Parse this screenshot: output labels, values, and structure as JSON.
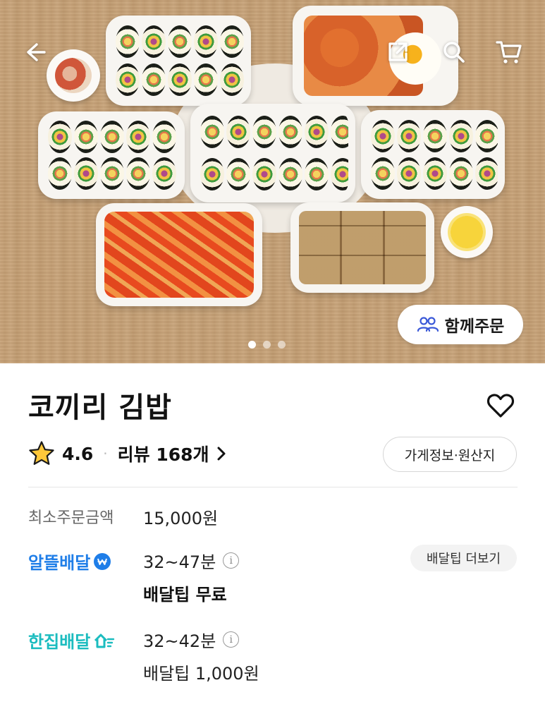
{
  "header": {
    "back_icon": "back-arrow-icon",
    "share_icon": "share-icon",
    "search_icon": "search-icon",
    "cart_icon": "cart-icon"
  },
  "hero": {
    "together_order_label": "함께주문",
    "together_icon": "people-group-icon",
    "carousel": {
      "total": 3,
      "active_index": 1
    }
  },
  "store": {
    "name": "코끼리 김밥",
    "rating": "4.6",
    "reviews_label": "리뷰 168개",
    "store_info_label": "가게정보·원산지"
  },
  "order": {
    "min_order_label": "최소주문금액",
    "min_order_value": "15,000원"
  },
  "delivery_options": [
    {
      "name": "알뜰배달",
      "time": "32~47분",
      "fee": "배달팁 무료",
      "color": "#1f7ee8"
    },
    {
      "name": "한집배달",
      "time": "32~42분",
      "fee": "배달팁 1,000원",
      "color": "#1bbcbf"
    }
  ],
  "tips_more_label": "배달팁 더보기",
  "info_glyph": "i"
}
